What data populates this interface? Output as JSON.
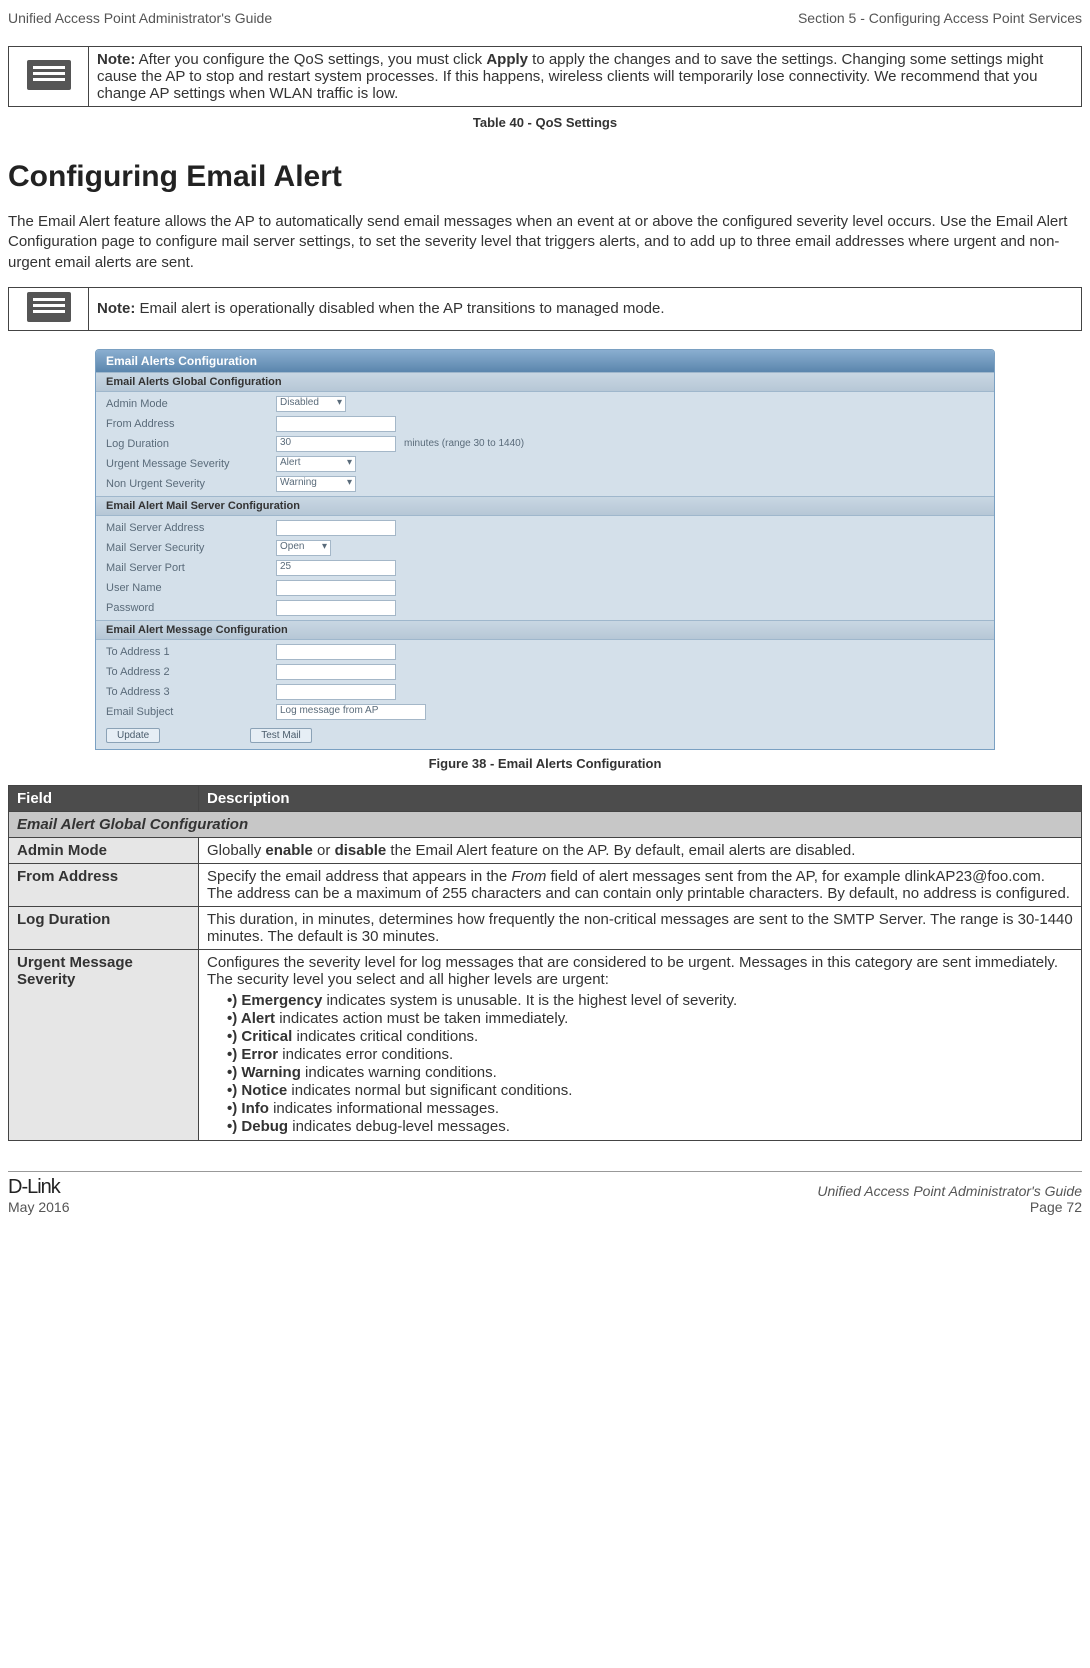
{
  "header": {
    "left": "Unified Access Point Administrator's Guide",
    "right": "Section 5 - Configuring Access Point Services"
  },
  "note1_prefix": "Note:",
  "note1_a": " After you configure the QoS settings, you must click ",
  "note1_bold": "Apply",
  "note1_b": " to apply the changes and to save the settings. Changing some settings might cause the AP to stop and restart system processes. If this happens, wireless clients will temporarily lose connectivity. We recommend that you change AP settings when WLAN traffic is low.",
  "table40": "Table 40 - QoS Settings",
  "h1": "Configuring Email Alert",
  "intro": "The Email Alert feature allows the AP to automatically send email messages when an event at or above the configured severity level occurs. Use the Email Alert Configuration page to configure mail server settings, to set the severity level that triggers alerts, and to add up to three email addresses where urgent and non-urgent email alerts are sent.",
  "note2_prefix": "Note:",
  "note2_body": " Email alert is operationally disabled when the AP transitions to managed mode.",
  "ss": {
    "title": "Email Alerts Configuration",
    "sec1": "Email Alerts Global Configuration",
    "admin_label": "Admin Mode",
    "admin_val": "Disabled",
    "from_label": "From Address",
    "logdur_label": "Log Duration",
    "logdur_val": "30",
    "logdur_hint": "minutes (range 30 to 1440)",
    "urg_label": "Urgent Message Severity",
    "urg_val": "Alert",
    "nonurg_label": "Non Urgent Severity",
    "nonurg_val": "Warning",
    "sec2": "Email Alert Mail Server Configuration",
    "msaddr_label": "Mail Server Address",
    "mssec_label": "Mail Server Security",
    "mssec_val": "Open",
    "msport_label": "Mail Server Port",
    "msport_val": "25",
    "user_label": "User Name",
    "pwd_label": "Password",
    "sec3": "Email Alert Message Configuration",
    "to1_label": "To Address 1",
    "to2_label": "To Address 2",
    "to3_label": "To Address 3",
    "subj_label": "Email Subject",
    "subj_val": "Log message from AP",
    "btn_update": "Update",
    "btn_test": "Test Mail"
  },
  "fig38": "Figure 38 - Email Alerts Configuration",
  "tbl": {
    "h_field": "Field",
    "h_desc": "Description",
    "sec": "Email Alert Global Configuration",
    "r1f": "Admin Mode",
    "r1a": "Globally ",
    "r1b1": "enable",
    "r1c": " or ",
    "r1b2": "disable",
    "r1d": " the Email Alert feature on the AP. By default, email alerts are disabled.",
    "r2f": "From Address",
    "r2a": "Specify the email address that appears in the ",
    "r2i": "From",
    "r2b": " field of alert messages sent from the AP, for example dlinkAP23@foo.com. The address can be a maximum of 255 characters and can contain only printable characters. By default, no address is configured.",
    "r3f": "Log Duration",
    "r3d": "This duration, in minutes, determines how frequently the non-critical messages are sent to the SMTP Server. The range is 30-1440 minutes. The default is 30 minutes.",
    "r4f": "Urgent Message Severity",
    "r4d": "Configures the severity level for log messages that are considered to be urgent. Messages in this category are sent immediately. The security level you select and all higher levels are urgent:",
    "b1a": "Emergency",
    "b1b": " indicates system is unusable. It is the highest level of severity.",
    "b2a": "Alert",
    "b2b": " indicates action must be taken immediately.",
    "b3a": "Critical",
    "b3b": " indicates critical conditions.",
    "b4a": "Error",
    "b4b": " indicates error conditions.",
    "b5a": "Warning",
    "b5b": " indicates warning conditions.",
    "b6a": "Notice",
    "b6b": " indicates normal but significant conditions.",
    "b7a": "Info",
    "b7b": " indicates informational messages.",
    "b8a": "Debug",
    "b8b": " indicates debug-level messages."
  },
  "footer": {
    "brand": "D-Link",
    "date": "May 2016",
    "title": "Unified Access Point Administrator's Guide",
    "page": "Page 72"
  }
}
